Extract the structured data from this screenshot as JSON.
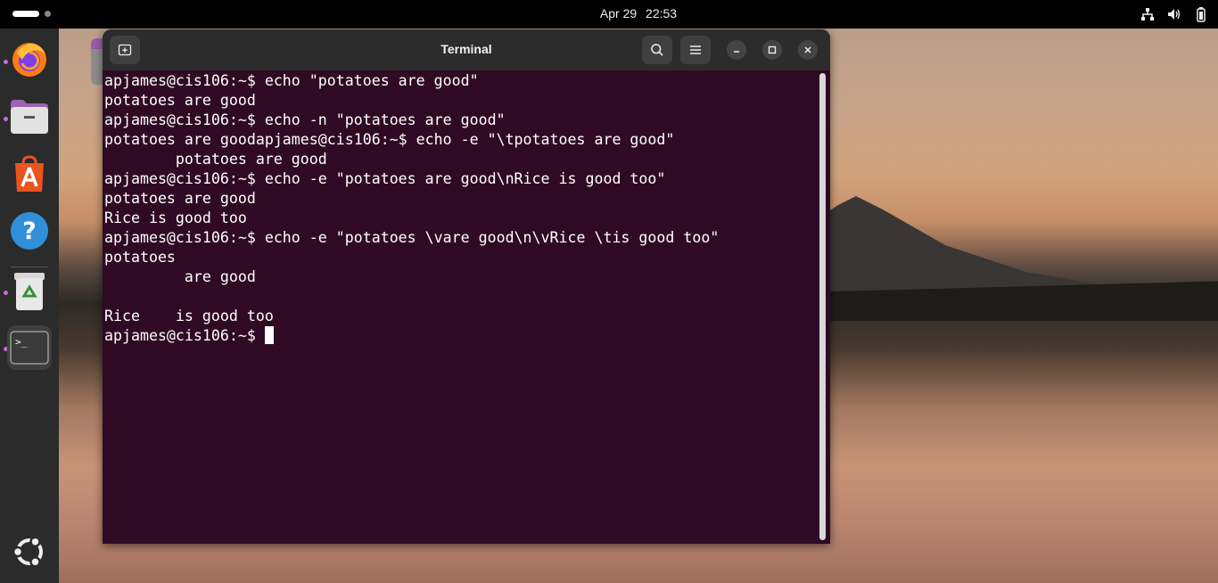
{
  "topbar": {
    "date": "Apr 29",
    "time": "22:53",
    "tray_icons": [
      "network-icon",
      "volume-icon",
      "battery-icon"
    ]
  },
  "dock": {
    "items": [
      {
        "name": "firefox",
        "icon": "firefox-icon",
        "running": true
      },
      {
        "name": "files",
        "icon": "files-icon",
        "running": true
      },
      {
        "name": "app-center",
        "icon": "app-center-icon",
        "running": false
      },
      {
        "name": "help",
        "icon": "help-icon",
        "running": false
      },
      {
        "name": "trash",
        "icon": "trash-icon",
        "running": true
      },
      {
        "name": "terminal",
        "icon": "terminal-icon",
        "running": true,
        "active": true
      }
    ],
    "show_apps_icon": "ubuntu-logo-icon"
  },
  "terminal": {
    "title": "Terminal",
    "lines": [
      "apjames@cis106:~$ echo \"potatoes are good\"",
      "potatoes are good",
      "apjames@cis106:~$ echo -n \"potatoes are good\"",
      "potatoes are goodapjames@cis106:~$ echo -e \"\\tpotatoes are good\"",
      "        potatoes are good",
      "apjames@cis106:~$ echo -e \"potatoes are good\\nRice is good too\"",
      "potatoes are good",
      "Rice is good too",
      "apjames@cis106:~$ echo -e \"potatoes \\vare good\\n\\vRice \\tis good too\"",
      "potatoes",
      "         are good",
      "",
      "Rice    is good too"
    ],
    "prompt": "apjames@cis106:~$ "
  },
  "colors": {
    "terminal_bg": "#300a24",
    "header_bg": "#2c2c2c",
    "dock_bg": "#2b2b2b",
    "running_dot": "#c76bd8"
  }
}
